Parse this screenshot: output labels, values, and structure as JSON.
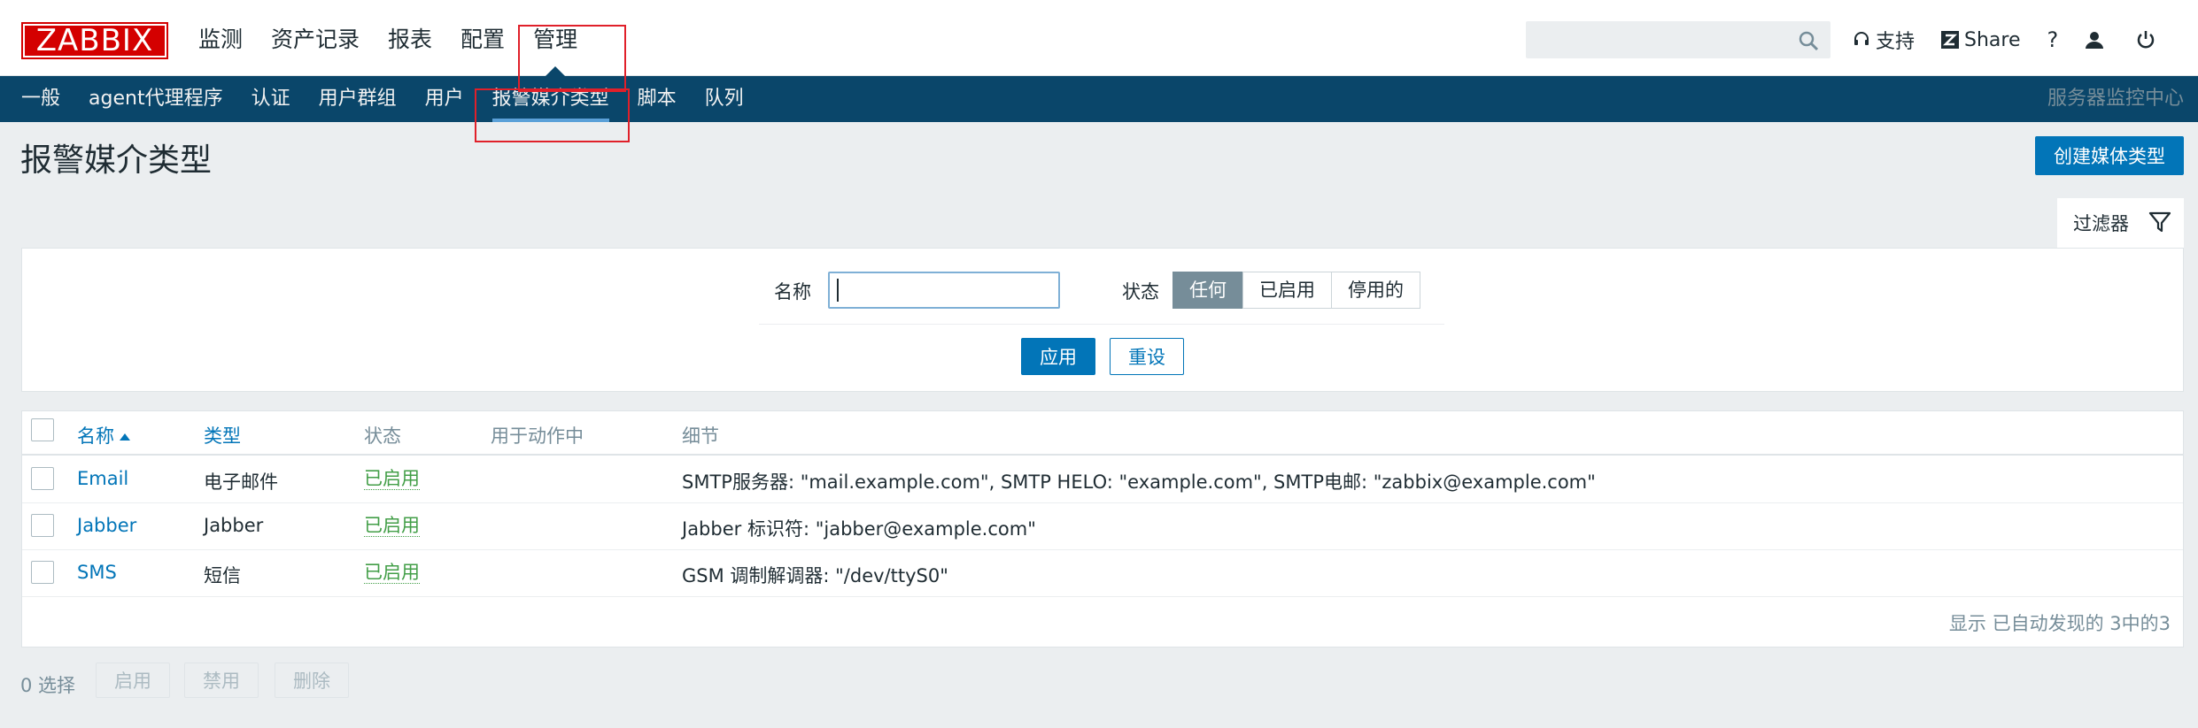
{
  "header": {
    "logo_text": "ZABBIX",
    "nav": [
      "监测",
      "资产记录",
      "报表",
      "配置",
      "管理"
    ],
    "active_nav": "管理",
    "search_placeholder": "",
    "support_label": "支持",
    "share_label": "Share",
    "help_label": "?"
  },
  "subnav": {
    "items": [
      "一般",
      "agent代理程序",
      "认证",
      "用户群组",
      "用户",
      "报警媒介类型",
      "脚本",
      "队列"
    ],
    "active": "报警媒介类型",
    "server_name": "服务器监控中心"
  },
  "page": {
    "title": "报警媒介类型",
    "create_button": "创建媒体类型"
  },
  "filter": {
    "tab_label": "过滤器",
    "name_label": "名称",
    "name_value": "",
    "status_label": "状态",
    "status_options": [
      "任何",
      "已启用",
      "停用的"
    ],
    "status_selected": "任何",
    "apply_label": "应用",
    "reset_label": "重设"
  },
  "table": {
    "columns": [
      "名称",
      "类型",
      "状态",
      "用于动作中",
      "细节"
    ],
    "sort_column": "名称",
    "rows": [
      {
        "name": "Email",
        "type": "电子邮件",
        "status": "已启用",
        "used_in_actions": "",
        "details": "SMTP服务器: \"mail.example.com\", SMTP HELO: \"example.com\", SMTP电邮: \"zabbix@example.com\""
      },
      {
        "name": "Jabber",
        "type": "Jabber",
        "status": "已启用",
        "used_in_actions": "",
        "details": "Jabber 标识符: \"jabber@example.com\""
      },
      {
        "name": "SMS",
        "type": "短信",
        "status": "已启用",
        "used_in_actions": "",
        "details": "GSM 调制解调器: \"/dev/ttyS0\""
      }
    ],
    "summary": "显示 已自动发现的 3中的3"
  },
  "footer": {
    "selected_count": "0 选择",
    "enable_label": "启用",
    "disable_label": "禁用",
    "delete_label": "删除"
  },
  "colors": {
    "brand_red": "#d40000",
    "nav_dark": "#0a466a",
    "primary_blue": "#0275b8",
    "status_green": "#429e47",
    "annotation_red": "#e0202a"
  }
}
